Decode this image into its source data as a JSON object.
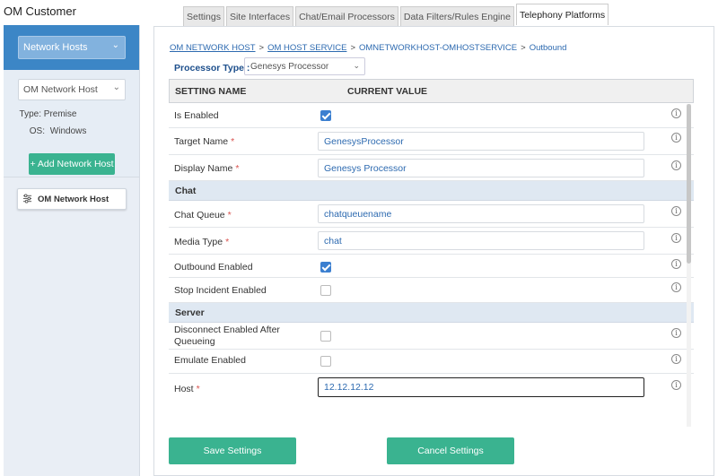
{
  "app": {
    "title": "OM Customer"
  },
  "sidebar": {
    "category_select": "Network Hosts",
    "host_select": "OM Network Host",
    "type_label": "Type:",
    "type_value": "Premise",
    "os_label": "OS:",
    "os_value": "Windows",
    "add_button": "+ Add Network Host",
    "host_card": "OM Network Host"
  },
  "tabs": [
    {
      "label": "Settings",
      "active": false
    },
    {
      "label": "Site Interfaces",
      "active": false
    },
    {
      "label": "Chat/Email Processors",
      "active": false
    },
    {
      "label": "Data Filters/Rules Engine",
      "active": false
    },
    {
      "label": "Telephony Platforms",
      "active": true
    }
  ],
  "breadcrumb": {
    "items": [
      "OM NETWORK HOST",
      "OM HOST SERVICE",
      "OMNETWORKHOST-OMHOSTSERVICE",
      "Outbound"
    ],
    "separator": ">"
  },
  "processor": {
    "label": "Processor Type :",
    "value": "Genesys Processor"
  },
  "table": {
    "col_setting": "SETTING NAME",
    "col_value": "CURRENT VALUE",
    "rows": {
      "is_enabled": {
        "label": "Is Enabled",
        "checked": true
      },
      "target_name": {
        "label": "Target Name",
        "value": "GenesysProcessor"
      },
      "display_name": {
        "label": "Display Name",
        "value": "Genesys Processor"
      },
      "section_chat": "Chat",
      "chat_queue": {
        "label": "Chat Queue",
        "value": "chatqueuename"
      },
      "media_type": {
        "label": "Media Type",
        "value": "chat"
      },
      "outbound_enabled": {
        "label": "Outbound Enabled",
        "checked": true
      },
      "stop_incident": {
        "label": "Stop Incident Enabled",
        "checked": false
      },
      "section_server": "Server",
      "disconnect_line1": "Disconnect Enabled After",
      "disconnect_line2": "Queueing",
      "emulate_enabled": {
        "label": "Emulate Enabled",
        "checked": false
      },
      "host": {
        "label": "Host",
        "value": "12.12.12.12"
      }
    },
    "required_mark": "*",
    "info_glyph": "i"
  },
  "buttons": {
    "save": "Save Settings",
    "cancel": "Cancel Settings"
  },
  "colors": {
    "primary_blue": "#3c86c6",
    "action_green": "#3ab390",
    "link_blue": "#2d6ab0",
    "check_blue": "#3b7fd0"
  }
}
